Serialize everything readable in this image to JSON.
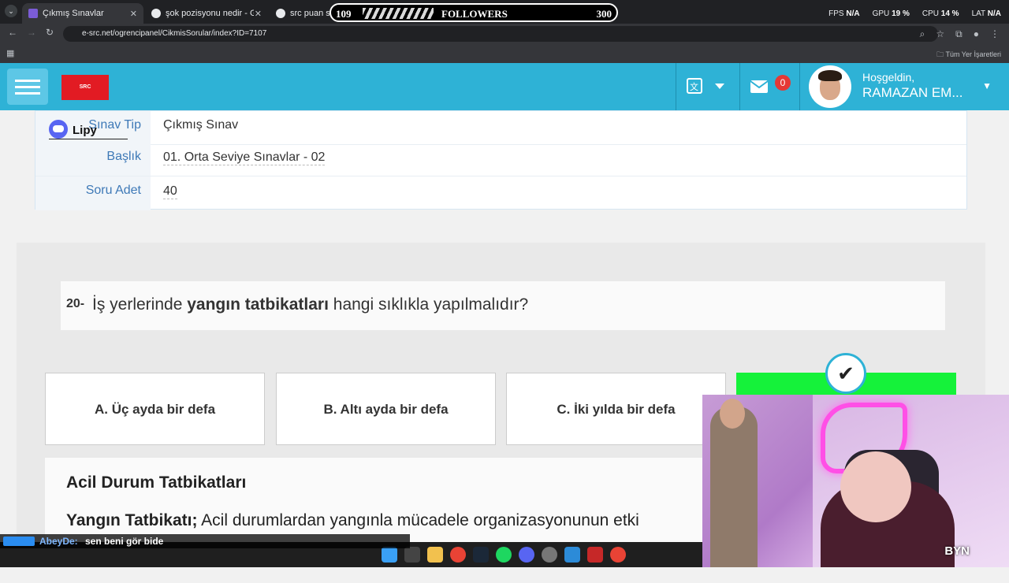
{
  "browser": {
    "tabs": [
      {
        "title": "Çıkmış Sınavlar",
        "active": true
      },
      {
        "title": "şok pozisyonu nedir - Google'da",
        "active": false
      },
      {
        "title": "src puan sınırı",
        "active": false
      }
    ],
    "url": "e-src.net/ogrencipanel/CikmisSorular/index?ID=7107",
    "bookmarks_label": "Tüm Yer İşaretleri"
  },
  "overlay": {
    "followers_current": "109",
    "followers_label": "FOLLOWERS",
    "followers_goal": "300",
    "stats": [
      {
        "label": "FPS",
        "value": "N/A"
      },
      {
        "label": "GPU",
        "value": "19 %"
      },
      {
        "label": "CPU",
        "value": "14 %"
      },
      {
        "label": "LAT",
        "value": "N/A"
      }
    ],
    "discord_name": "Lipy",
    "chat_user": "AbeyDe:",
    "chat_message": "sen beni gör bide",
    "cam_logo": "BYN"
  },
  "header": {
    "mail_count": "0",
    "greeting": "Hoşgeldin,",
    "user_name": "RAMAZAN EM..."
  },
  "info": {
    "rows": [
      {
        "label": "Sınav Tip",
        "value": "Çıkmış Sınav"
      },
      {
        "label": "Başlık",
        "value": "01. Orta Seviye Sınavlar - 02"
      },
      {
        "label": "Soru Adet",
        "value": "40"
      }
    ]
  },
  "question": {
    "number": "20-",
    "text_before": "İş yerlerinde ",
    "text_bold": "yangın tatbikatları",
    "text_after": " hangi sıklıkla yapılmalıdır?",
    "options": [
      {
        "label": "A. Üç ayda bir defa"
      },
      {
        "label": "B. Altı ayda bir defa"
      },
      {
        "label": "C. İki yılda bir defa"
      }
    ]
  },
  "explanation": {
    "heading": "Acil Durum Tatbikatları",
    "term": "Yangın Tatbikatı;",
    "text": " Acil durumlardan yangınla mücadele organizasyonunun etki"
  }
}
